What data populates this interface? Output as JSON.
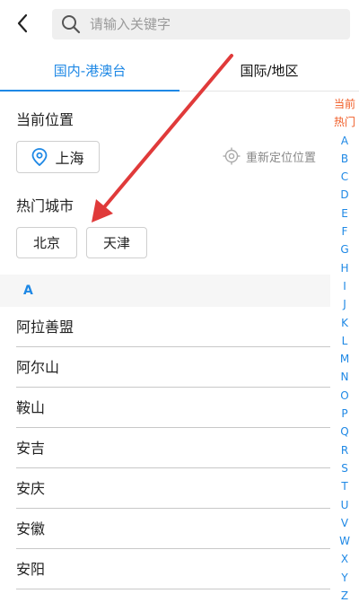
{
  "search": {
    "placeholder": "请输入关键字"
  },
  "tabs": [
    "国内-港澳台",
    "国际/地区"
  ],
  "current_location": {
    "title": "当前位置",
    "city": "上海",
    "relocate_label": "重新定位位置"
  },
  "hot_cities": {
    "title": "热门城市",
    "items": [
      "北京",
      "天津"
    ]
  },
  "group": {
    "letter": "A",
    "cities": [
      "阿拉善盟",
      "阿尔山",
      "鞍山",
      "安吉",
      "安庆",
      "安徽",
      "安阳"
    ]
  },
  "index_bar": [
    "当前",
    "热门",
    "A",
    "B",
    "C",
    "D",
    "E",
    "F",
    "G",
    "H",
    "I",
    "J",
    "K",
    "L",
    "M",
    "N",
    "O",
    "P",
    "Q",
    "R",
    "S",
    "T",
    "U",
    "V",
    "W",
    "X",
    "Y",
    "Z"
  ],
  "colors": {
    "accent": "#1e88e5",
    "index_highlight": "#f05a23",
    "annotation_arrow": "#e03a3a"
  }
}
